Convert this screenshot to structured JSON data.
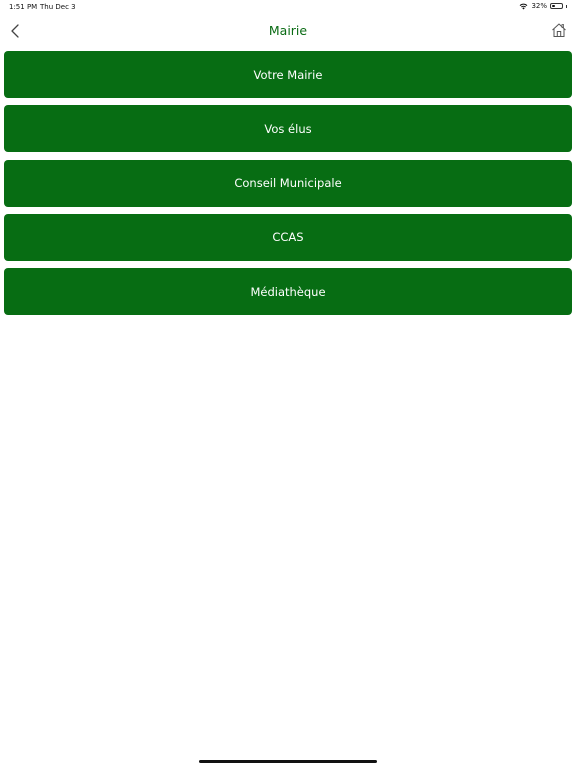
{
  "status_bar": {
    "time": "1:51 PM",
    "date": "Thu Dec 3",
    "battery_percent": "32%",
    "battery_level": 0.32
  },
  "nav": {
    "title": "Mairie",
    "back_icon": "chevron-left-icon",
    "home_icon": "home-icon"
  },
  "colors": {
    "accent": "#076d13",
    "title": "#0a6b14",
    "background": "#ffffff"
  },
  "menu": {
    "items": [
      {
        "label": "Votre Mairie"
      },
      {
        "label": "Vos élus"
      },
      {
        "label": "Conseil Municipale"
      },
      {
        "label": "CCAS"
      },
      {
        "label": "Médiathèque"
      }
    ]
  }
}
